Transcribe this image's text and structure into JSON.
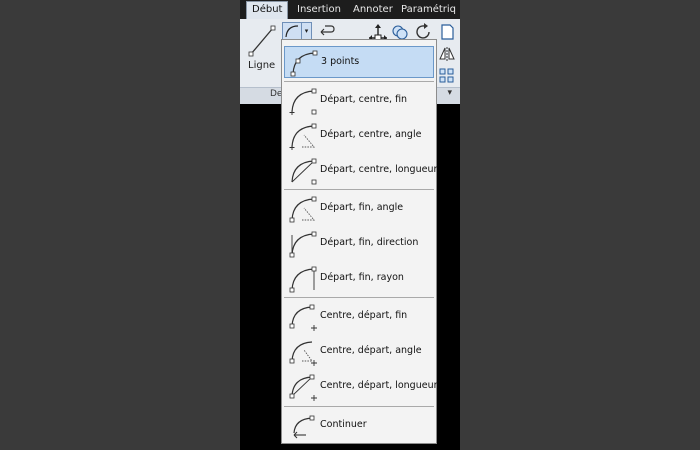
{
  "tabs": [
    {
      "label": "Début",
      "active": true
    },
    {
      "label": "Insertion",
      "active": false
    },
    {
      "label": "Annoter",
      "active": false
    },
    {
      "label": "Paramétriq",
      "active": false
    }
  ],
  "ribbon": {
    "line_label": "Ligne",
    "panel_label": "De"
  },
  "menu": {
    "items": [
      {
        "label": "3 points",
        "icon": "arc-3points-icon",
        "selected": true
      },
      {
        "label": "Départ, centre, fin",
        "icon": "arc-start-center-end-icon"
      },
      {
        "label": "Départ, centre, angle",
        "icon": "arc-start-center-angle-icon"
      },
      {
        "label": "Départ, centre, longueur",
        "icon": "arc-start-center-length-icon"
      },
      {
        "label": "Départ, fin, angle",
        "icon": "arc-start-end-angle-icon"
      },
      {
        "label": "Départ, fin, direction",
        "icon": "arc-start-end-direction-icon"
      },
      {
        "label": "Départ, fin, rayon",
        "icon": "arc-start-end-radius-icon"
      },
      {
        "label": "Centre, départ, fin",
        "icon": "arc-center-start-end-icon"
      },
      {
        "label": "Centre, départ, angle",
        "icon": "arc-center-start-angle-icon"
      },
      {
        "label": "Centre, départ, longueur",
        "icon": "arc-center-start-length-icon"
      },
      {
        "label": "Continuer",
        "icon": "arc-continue-icon"
      }
    ]
  },
  "colors": {
    "selected_bg": "#c5dcf4",
    "menu_bg": "#f3f3f3",
    "canvas": "#000000"
  }
}
